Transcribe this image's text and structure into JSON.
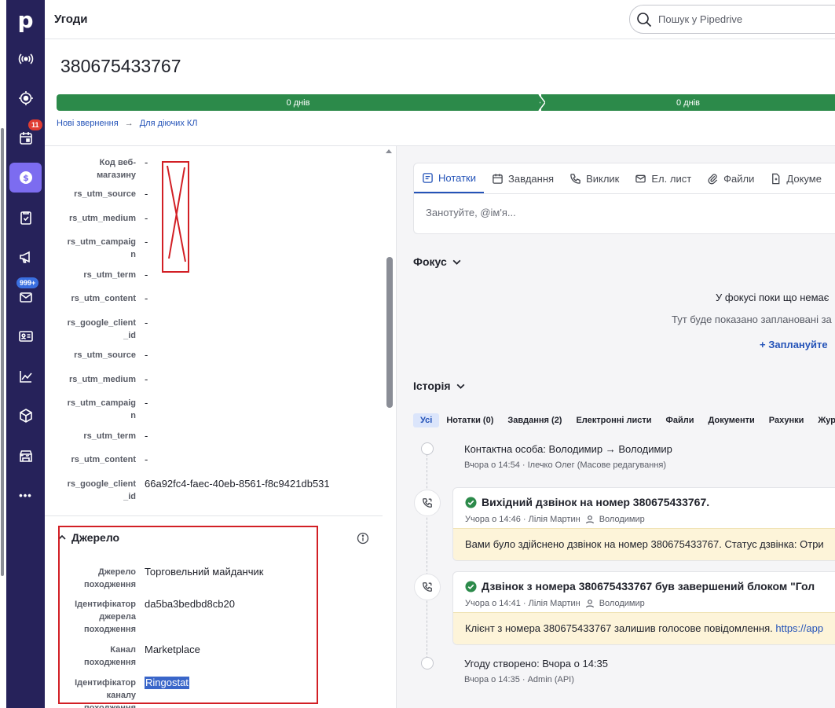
{
  "colors": {
    "sidebar_bg": "#26225a",
    "sidebar_active": "#7c6cf0",
    "pipeline_green": "#2c8a4a",
    "link_blue": "#2453b8",
    "annotation_red": "#d21f25",
    "note_bg": "#fdf4d9"
  },
  "sidebar": {
    "logo": "p",
    "items": [
      {
        "icon": "broadcast-icon"
      },
      {
        "icon": "target-icon"
      },
      {
        "icon": "calendar-icon",
        "badge": "11"
      },
      {
        "icon": "dollar-icon",
        "active": true
      },
      {
        "icon": "clipboard-icon"
      },
      {
        "icon": "megaphone-icon"
      },
      {
        "icon": "mail-icon",
        "badge": "999+"
      },
      {
        "icon": "contact-card-icon"
      },
      {
        "icon": "chart-icon"
      },
      {
        "icon": "box-icon"
      },
      {
        "icon": "store-icon"
      },
      {
        "icon": "more-icon",
        "label": "•••"
      }
    ]
  },
  "header": {
    "title": "Угоди",
    "search_placeholder": "Пошук у Pipedrive"
  },
  "deal": {
    "title": "380675433767",
    "stages": [
      "0 днів",
      "0 днів"
    ],
    "breadcrumb": [
      "Нові звернення",
      "→",
      "Для діючих КЛ"
    ]
  },
  "details": {
    "fields": [
      {
        "label": "Код веб-магазину",
        "value": "-"
      },
      {
        "label": "rs_utm_source",
        "value": "-"
      },
      {
        "label": "rs_utm_medium",
        "value": "-"
      },
      {
        "label": "rs_utm_campaign",
        "value": "-"
      },
      {
        "label": "rs_utm_term",
        "value": "-"
      },
      {
        "label": "rs_utm_content",
        "value": "-"
      },
      {
        "label": "rs_google_client_id",
        "value": "-"
      },
      {
        "label": "rs_utm_source",
        "value": "-"
      },
      {
        "label": "rs_utm_medium",
        "value": "-"
      },
      {
        "label": "rs_utm_campaign",
        "value": "-"
      },
      {
        "label": "rs_utm_term",
        "value": "-"
      },
      {
        "label": "rs_utm_content",
        "value": "-"
      },
      {
        "label": "rs_google_client_id",
        "value": "66a92fc4-faec-40eb-8561-f8c9421db531"
      }
    ],
    "source_section": {
      "title": "Джерело",
      "fields": [
        {
          "label": "Джерело походження",
          "value": "Торговельний майданчик"
        },
        {
          "label": "Ідентифікатор джерела походження",
          "value": "da5ba3bedbd8cb20"
        },
        {
          "label": "Канал походження",
          "value": "Marketplace"
        },
        {
          "label": "Ідентифікатор каналу походження",
          "value": "Ringostat"
        }
      ]
    }
  },
  "composer": {
    "tabs": [
      {
        "label": "Нотатки",
        "icon": "note-icon"
      },
      {
        "label": "Завдання",
        "icon": "calendar-icon"
      },
      {
        "label": "Виклик",
        "icon": "phone-icon"
      },
      {
        "label": "Ел. лист",
        "icon": "mail-icon"
      },
      {
        "label": "Файли",
        "icon": "paperclip-icon"
      },
      {
        "label": "Докуме",
        "icon": "document-icon"
      }
    ],
    "placeholder": "Занотуйте, @ім'я..."
  },
  "focus": {
    "title": "Фокус",
    "empty_title": "У фокусі поки що немає",
    "empty_text": "Тут буде показано заплановані за",
    "action": "+ Заплануйте"
  },
  "history": {
    "title": "Історія",
    "filters": [
      "Усі",
      "Нотатки (0)",
      "Завдання (2)",
      "Електронні листи",
      "Файли",
      "Документи",
      "Рахунки",
      "Жур"
    ],
    "items": [
      {
        "type": "change",
        "text": "Контактна особа: Володимир → Володимир",
        "meta": "Вчора о 14:54 · Ілечко Олег (Масове редагування)"
      },
      {
        "type": "call",
        "title": "Вихідний дзвінок на номер 380675433767.",
        "meta": "Учора о 14:46 · Лілія Мартин",
        "person": "Володимир",
        "note": "Вами було здійснено дзвінок на номер 380675433767. Статус дзвінка: Отри"
      },
      {
        "type": "call",
        "title": "Дзвінок з номера 380675433767 був завершений блоком \"Гол",
        "meta": "Учора о 14:41 · Лілія Мартин",
        "person": "Володимир",
        "note": "Клієнт з номера 380675433767 залишив голосове повідомлення.",
        "note_link": "https://app"
      },
      {
        "type": "created",
        "text": "Угоду створено: Вчора о 14:35",
        "meta": "Вчора о 14:35 · Admin (API)"
      }
    ]
  }
}
